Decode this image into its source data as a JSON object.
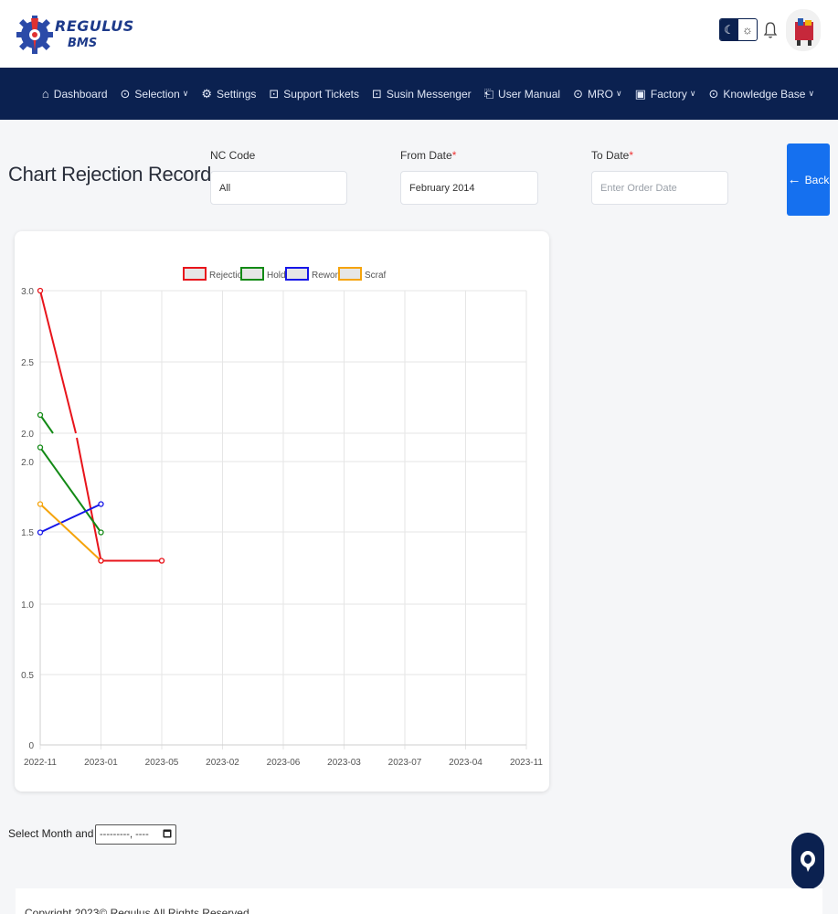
{
  "header": {
    "logo_line1": "REGULUS",
    "logo_line2": "BMS"
  },
  "nav": {
    "items": [
      {
        "label": "Dashboard",
        "icon": "home-icon",
        "glyph": "⌂",
        "dropdown": false
      },
      {
        "label": "Selection",
        "icon": "check-circle-icon",
        "glyph": "⊙",
        "dropdown": true
      },
      {
        "label": "Settings",
        "icon": "gear-icon",
        "glyph": "⚙",
        "dropdown": false
      },
      {
        "label": "Support Tickets",
        "icon": "ticket-icon",
        "glyph": "⊡",
        "dropdown": false
      },
      {
        "label": "Susin Messenger",
        "icon": "message-icon",
        "glyph": "⊡",
        "dropdown": false
      },
      {
        "label": "User Manual",
        "icon": "clipboard-icon",
        "glyph": "⎗",
        "dropdown": false
      },
      {
        "label": "MRO",
        "icon": "check-circle-icon",
        "glyph": "⊙",
        "dropdown": true
      },
      {
        "label": "Factory",
        "icon": "id-card-icon",
        "glyph": "▣",
        "dropdown": true
      },
      {
        "label": "Knowledge Base",
        "icon": "check-circle-icon",
        "glyph": "⊙",
        "dropdown": true
      }
    ]
  },
  "page": {
    "title": "Chart Rejection Record",
    "back_label": "Back"
  },
  "filters": {
    "nc_code_label": "NC Code",
    "nc_code_value": "All",
    "from_date_label": "From Date",
    "from_date_value": "February 2014",
    "to_date_label": "To Date",
    "to_date_placeholder": "Enter Order Date",
    "required_mark": "*"
  },
  "chart_data": {
    "type": "line",
    "categories": [
      "2022-11",
      "2023-01",
      "2023-05",
      "2023-02",
      "2023-06",
      "2023-03",
      "2023-07",
      "2023-04",
      "2023-11"
    ],
    "y_ticks": [
      "3.0",
      "2.5",
      "2.0",
      "2.0",
      "1.5",
      "1.0",
      "0.5",
      "0"
    ],
    "ylim": [
      0,
      3.0
    ],
    "grid": true,
    "legend_position": "top",
    "series": [
      {
        "name": "Rejection",
        "color": "#e8141b",
        "values": [
          3.0,
          1.3,
          1.3
        ]
      },
      {
        "name": "Hold",
        "color": "#138a16",
        "values": [
          2.1,
          1.5
        ]
      },
      {
        "name": "Rework",
        "color": "#1616e8",
        "values": [
          1.5,
          1.7
        ]
      },
      {
        "name": "Scraf",
        "color": "#f5a40c",
        "values": [
          1.7,
          1.3
        ]
      }
    ]
  },
  "month_picker": {
    "label": "Select Month and Year:",
    "value": "---------, ----"
  },
  "footer": {
    "text": "Copyright 2023© Regulus All Rights Reserved"
  }
}
